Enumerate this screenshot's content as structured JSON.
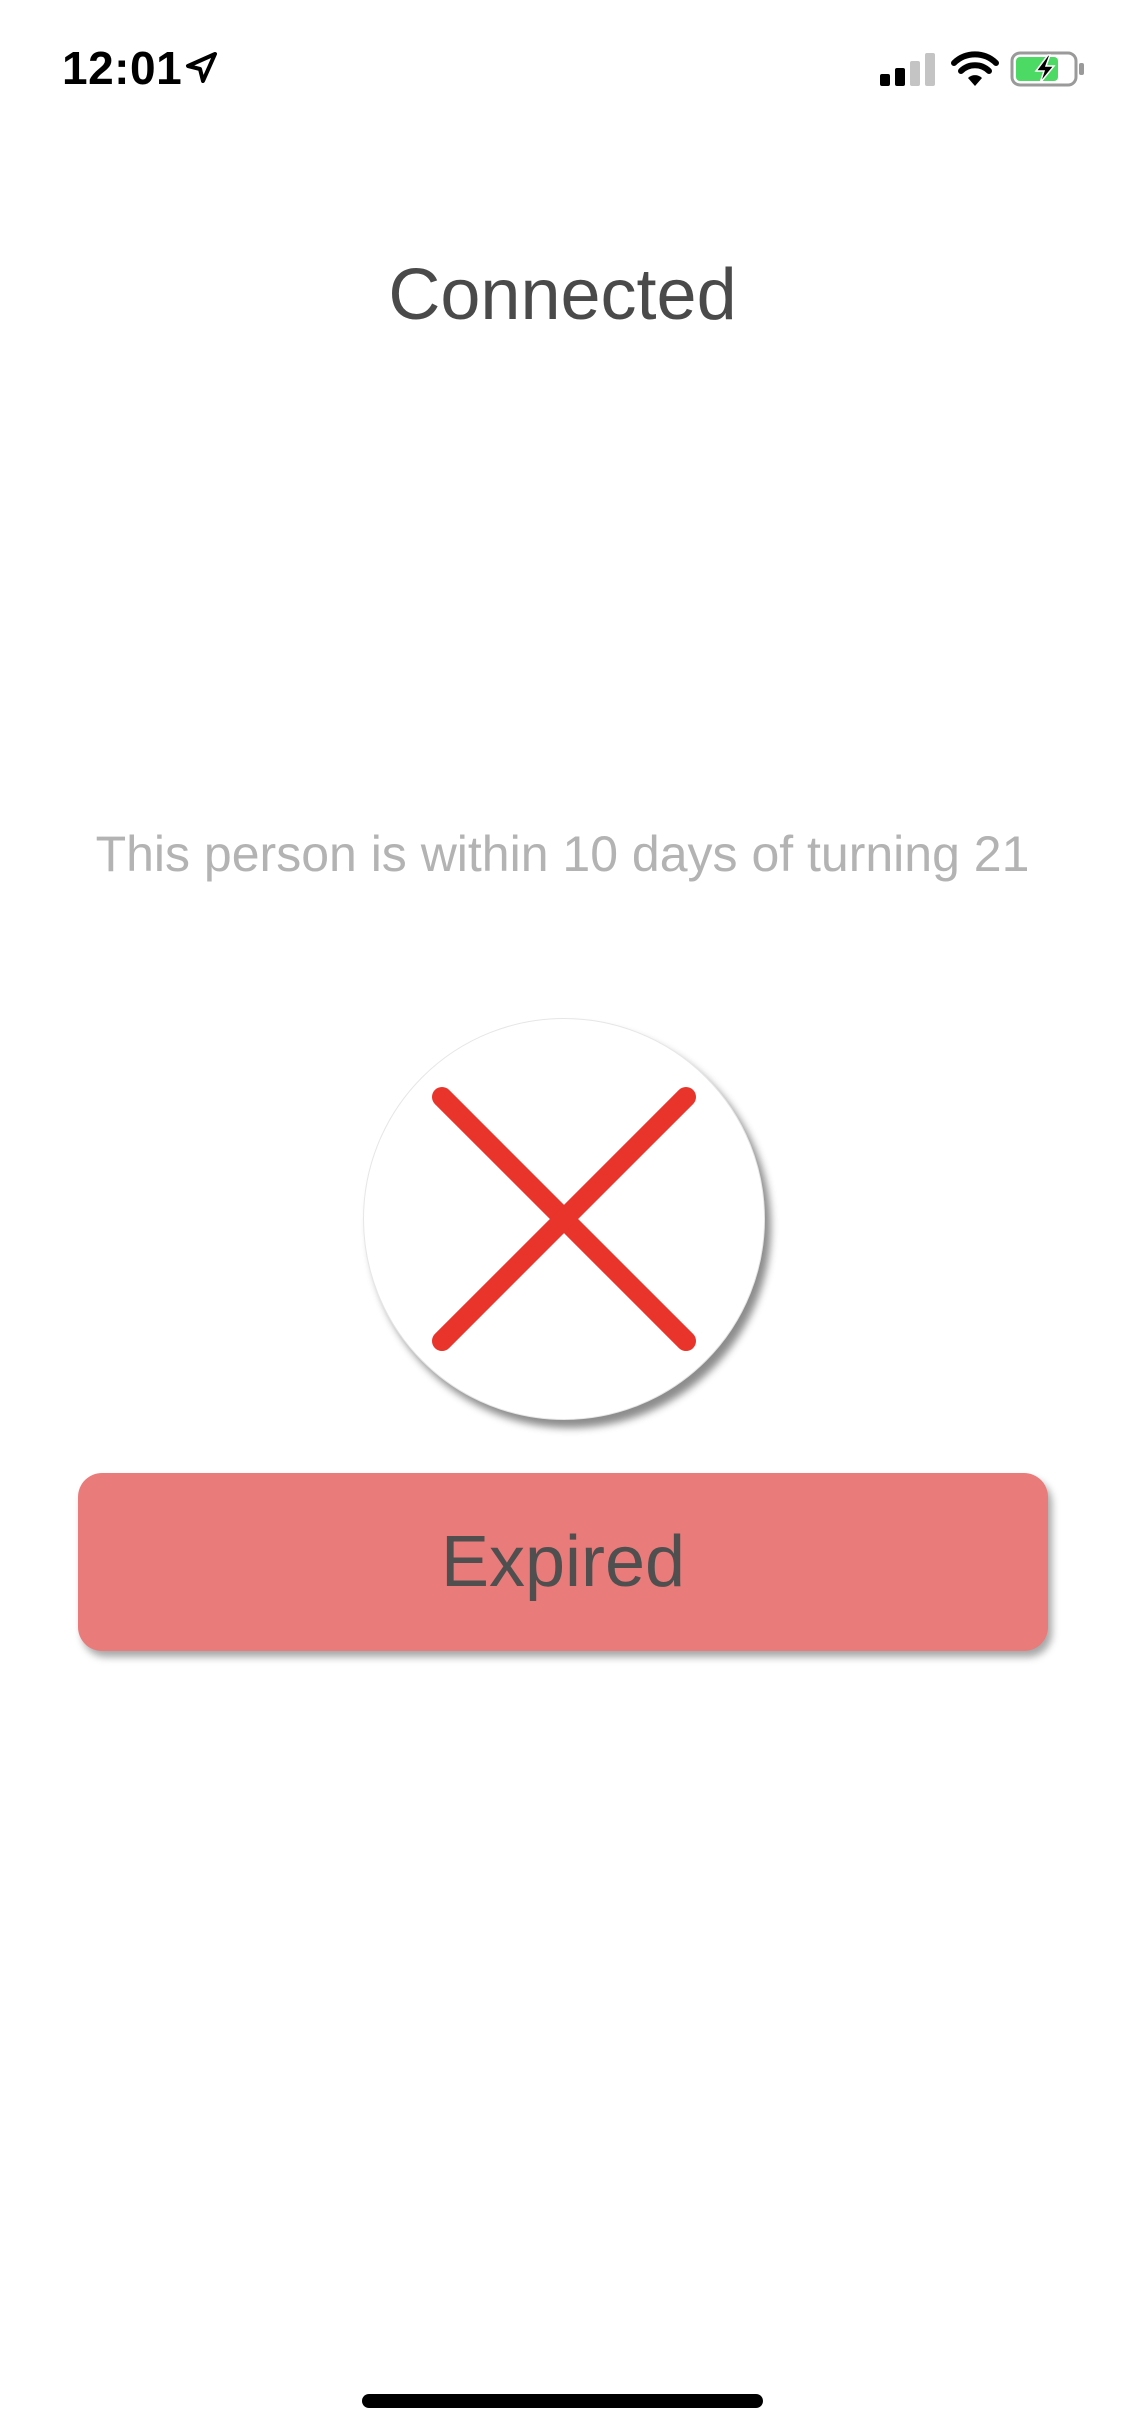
{
  "status_bar": {
    "time": "12:01",
    "icons": {
      "location": "location-arrow-icon",
      "signal": "cellular-signal-icon",
      "wifi": "wifi-icon",
      "battery": "battery-charging-icon"
    },
    "signal_bars_filled": 2,
    "signal_bars_total": 4
  },
  "header": {
    "title": "Connected"
  },
  "main": {
    "message": "This person is within 10 days of turning 21",
    "status_icon": "x-mark-icon",
    "button_label": "Expired"
  },
  "colors": {
    "x_mark": "#e8342a",
    "button_background": "#e97b7a",
    "battery_fill": "#4cd964",
    "title_text": "#4a4a4a",
    "message_text": "#b3b3b3"
  }
}
